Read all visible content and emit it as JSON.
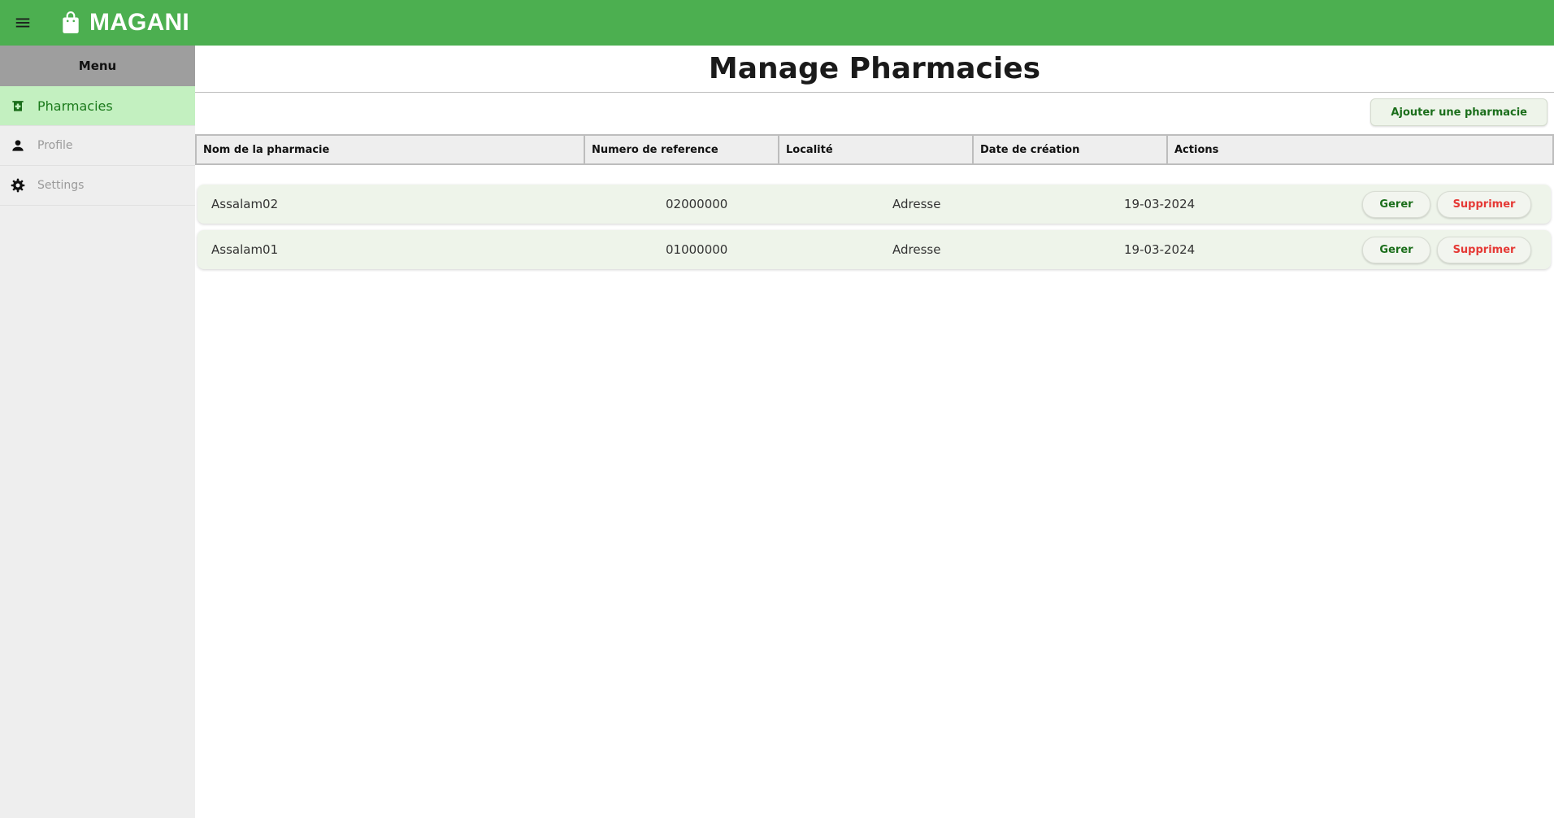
{
  "header": {
    "app_name": "MAGANI",
    "accent_color": "#4caf50",
    "menu_icon": "menu-icon",
    "brand_icon": "shopping-bag-icon"
  },
  "sidebar": {
    "title": "Menu",
    "items": [
      {
        "label": "Pharmacies",
        "icon": "pharmacy-icon",
        "active": true
      },
      {
        "label": "Profile",
        "icon": "person-icon",
        "active": false
      },
      {
        "label": "Settings",
        "icon": "gear-icon",
        "active": false
      }
    ]
  },
  "main": {
    "title": "Manage Pharmacies",
    "add_button": "Ajouter une pharmacie",
    "table": {
      "headers": [
        "Nom de la pharmacie",
        "Numero de reference",
        "Localité",
        "Date de création",
        "Actions"
      ],
      "rows": [
        {
          "name": "Assalam02",
          "ref": "02000000",
          "location": "Adresse",
          "date": "19-03-2024",
          "manage": "Gerer",
          "delete": "Supprimer"
        },
        {
          "name": "Assalam01",
          "ref": "01000000",
          "location": "Adresse",
          "date": "19-03-2024",
          "manage": "Gerer",
          "delete": "Supprimer"
        }
      ]
    }
  }
}
